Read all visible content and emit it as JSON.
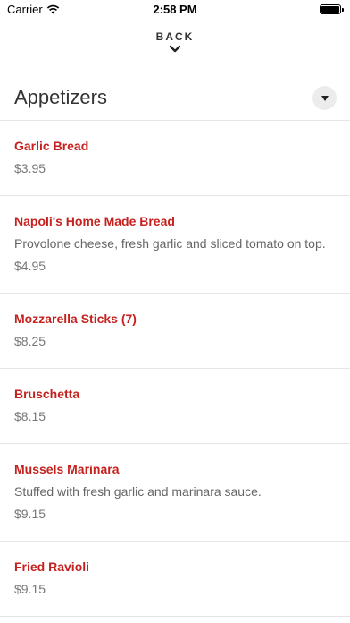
{
  "status_bar": {
    "carrier": "Carrier",
    "time": "2:58 PM",
    "icons": [
      "wifi-icon",
      "battery-icon"
    ]
  },
  "nav": {
    "back_label": "BACK",
    "back_icon": "chevron-down-icon"
  },
  "category": {
    "title": "Appetizers",
    "dropdown_icon": "caret-down-icon"
  },
  "colors": {
    "item_name": "#c5221f",
    "price": "#777777",
    "divider": "#e6e6e6"
  },
  "items": [
    {
      "name": "Garlic Bread",
      "description": "",
      "price": "$3.95"
    },
    {
      "name": "Napoli's Home Made Bread",
      "description": "Provolone cheese, fresh garlic and sliced tomato on top.",
      "price": "$4.95"
    },
    {
      "name": "Mozzarella Sticks (7)",
      "description": "",
      "price": "$8.25"
    },
    {
      "name": "Bruschetta",
      "description": "",
      "price": "$8.15"
    },
    {
      "name": "Mussels Marinara",
      "description": "Stuffed with fresh garlic and marinara sauce.",
      "price": "$9.15"
    },
    {
      "name": "Fried Ravioli",
      "description": "",
      "price": "$9.15"
    }
  ]
}
